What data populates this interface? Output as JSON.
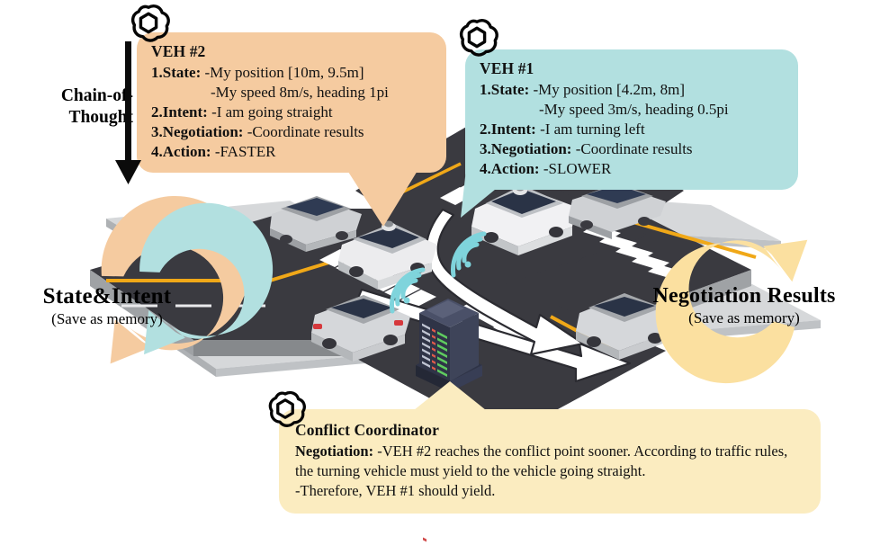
{
  "figure": {
    "title": "LLM-based multi-vehicle negotiation at an unsignalized intersection",
    "background": "#ffffff"
  },
  "colors": {
    "veh2_bubble": "#F5CBA0",
    "veh1_bubble": "#B2E0E0",
    "coordinator_bubble": "#FBECC0",
    "arrow_state_outer": "#F5CBA0",
    "arrow_state_inner": "#B2E0E0",
    "arrow_negotiation": "#FBE0A0",
    "road_asphalt": "#3A3A40",
    "road_kerb": "#C9CBCD",
    "lane_yellow": "#F0A818",
    "crosswalk_white": "#FFFFFF",
    "server_body": "#3C4256",
    "signal_wave": "#7FD4DC",
    "trajectory_arrow": "#FFFFFF",
    "text": "#111111"
  },
  "chain_of_thought": {
    "line1": "Chain-of-",
    "line2": "Thought",
    "arrow_icon": "down-arrow-icon"
  },
  "veh2_bubble": {
    "title": "VEH #2",
    "rows": [
      {
        "label": "1.State:",
        "text": "-My position [10m, 9.5m]"
      },
      {
        "label": "",
        "text": "-My speed 8m/s, heading 1pi",
        "indent": true
      },
      {
        "label": "2.Intent:",
        "text": "-I am going straight"
      },
      {
        "label": "3.Negotiation:",
        "text": "-Coordinate results"
      },
      {
        "label": "4.Action:",
        "text": "-FASTER"
      }
    ]
  },
  "veh1_bubble": {
    "title": "VEH #1",
    "rows": [
      {
        "label": "1.State:",
        "text": "-My position [4.2m, 8m]"
      },
      {
        "label": "",
        "text": "-My speed 3m/s, heading 0.5pi",
        "indent": true
      },
      {
        "label": "2.Intent:",
        "text": "-I am turning left"
      },
      {
        "label": "3.Negotiation:",
        "text": "-Coordinate results"
      },
      {
        "label": "4.Action:",
        "text": "-SLOWER"
      }
    ]
  },
  "coordinator_bubble": {
    "title": "Conflict Coordinator",
    "rows": [
      {
        "label": "Negotiation:",
        "text": "-VEH #2 reaches the conflict point sooner. According to traffic rules, the turning vehicle must yield to the vehicle going straight."
      },
      {
        "label": "",
        "text": "-Therefore, VEH #1 should yield."
      }
    ]
  },
  "left_loop": {
    "big": "State&Intent",
    "sub": "(Save as memory)"
  },
  "right_loop": {
    "big": "Negotiation Results",
    "sub": "(Save as memory)"
  },
  "scene": {
    "name": "isometric-four-way-intersection",
    "vehicles": [
      {
        "id": "veh2",
        "name": "vehicle-veh2-straight",
        "role": "going straight",
        "color": "#E8E8EA"
      },
      {
        "id": "veh1",
        "name": "vehicle-veh1-turning-left",
        "role": "turning left",
        "color": "#EFEFF1"
      },
      {
        "id": "bg-north",
        "name": "vehicle-background-north",
        "role": "queued",
        "color": "#D7D8DA"
      },
      {
        "id": "bg-west",
        "name": "vehicle-background-west",
        "role": "queued",
        "color": "#D7D8DA"
      },
      {
        "id": "bg-east",
        "name": "vehicle-background-east",
        "role": "queued",
        "color": "#D7D8DA"
      },
      {
        "id": "bg-south",
        "name": "vehicle-background-south",
        "role": "queued",
        "color": "#D7D8DA"
      }
    ],
    "roadside_unit": {
      "name": "edge-server-rack",
      "led_rows": 9
    },
    "trajectories": [
      {
        "name": "trajectory-straight-arrow",
        "for": "veh2"
      },
      {
        "name": "trajectory-left-turn-arrow",
        "for": "veh1"
      }
    ],
    "signal_waves": 2
  },
  "icons": {
    "openai_logo": "openai-logo-icon",
    "down_arrow": "down-arrow-icon",
    "loop_arrow": "loop-arrow-icon"
  }
}
